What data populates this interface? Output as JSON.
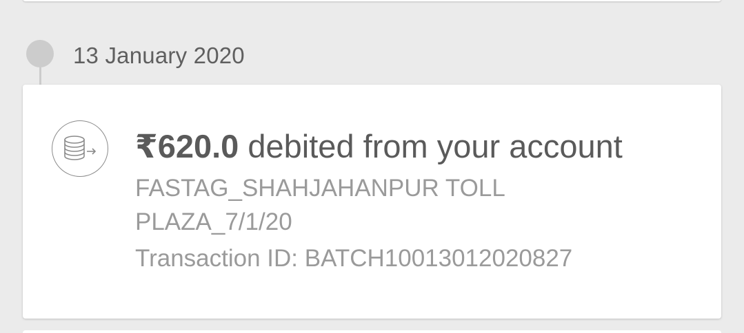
{
  "timeline": {
    "date": "13 January 2020"
  },
  "transaction": {
    "icon": "coins-debit-icon",
    "amount": "₹620.0",
    "description": "debited from your account",
    "merchant_line1": "FASTAG_SHAHJAHANPUR TOLL",
    "merchant_line2": "PLAZA_7/1/20",
    "transaction_id": "Transaction ID: BATCH10013012020827"
  },
  "colors": {
    "background": "#ebebeb",
    "card": "#ffffff",
    "headline": "#5a5a5a",
    "secondary_text": "#9a9a9a",
    "timeline": "#cccccc"
  }
}
